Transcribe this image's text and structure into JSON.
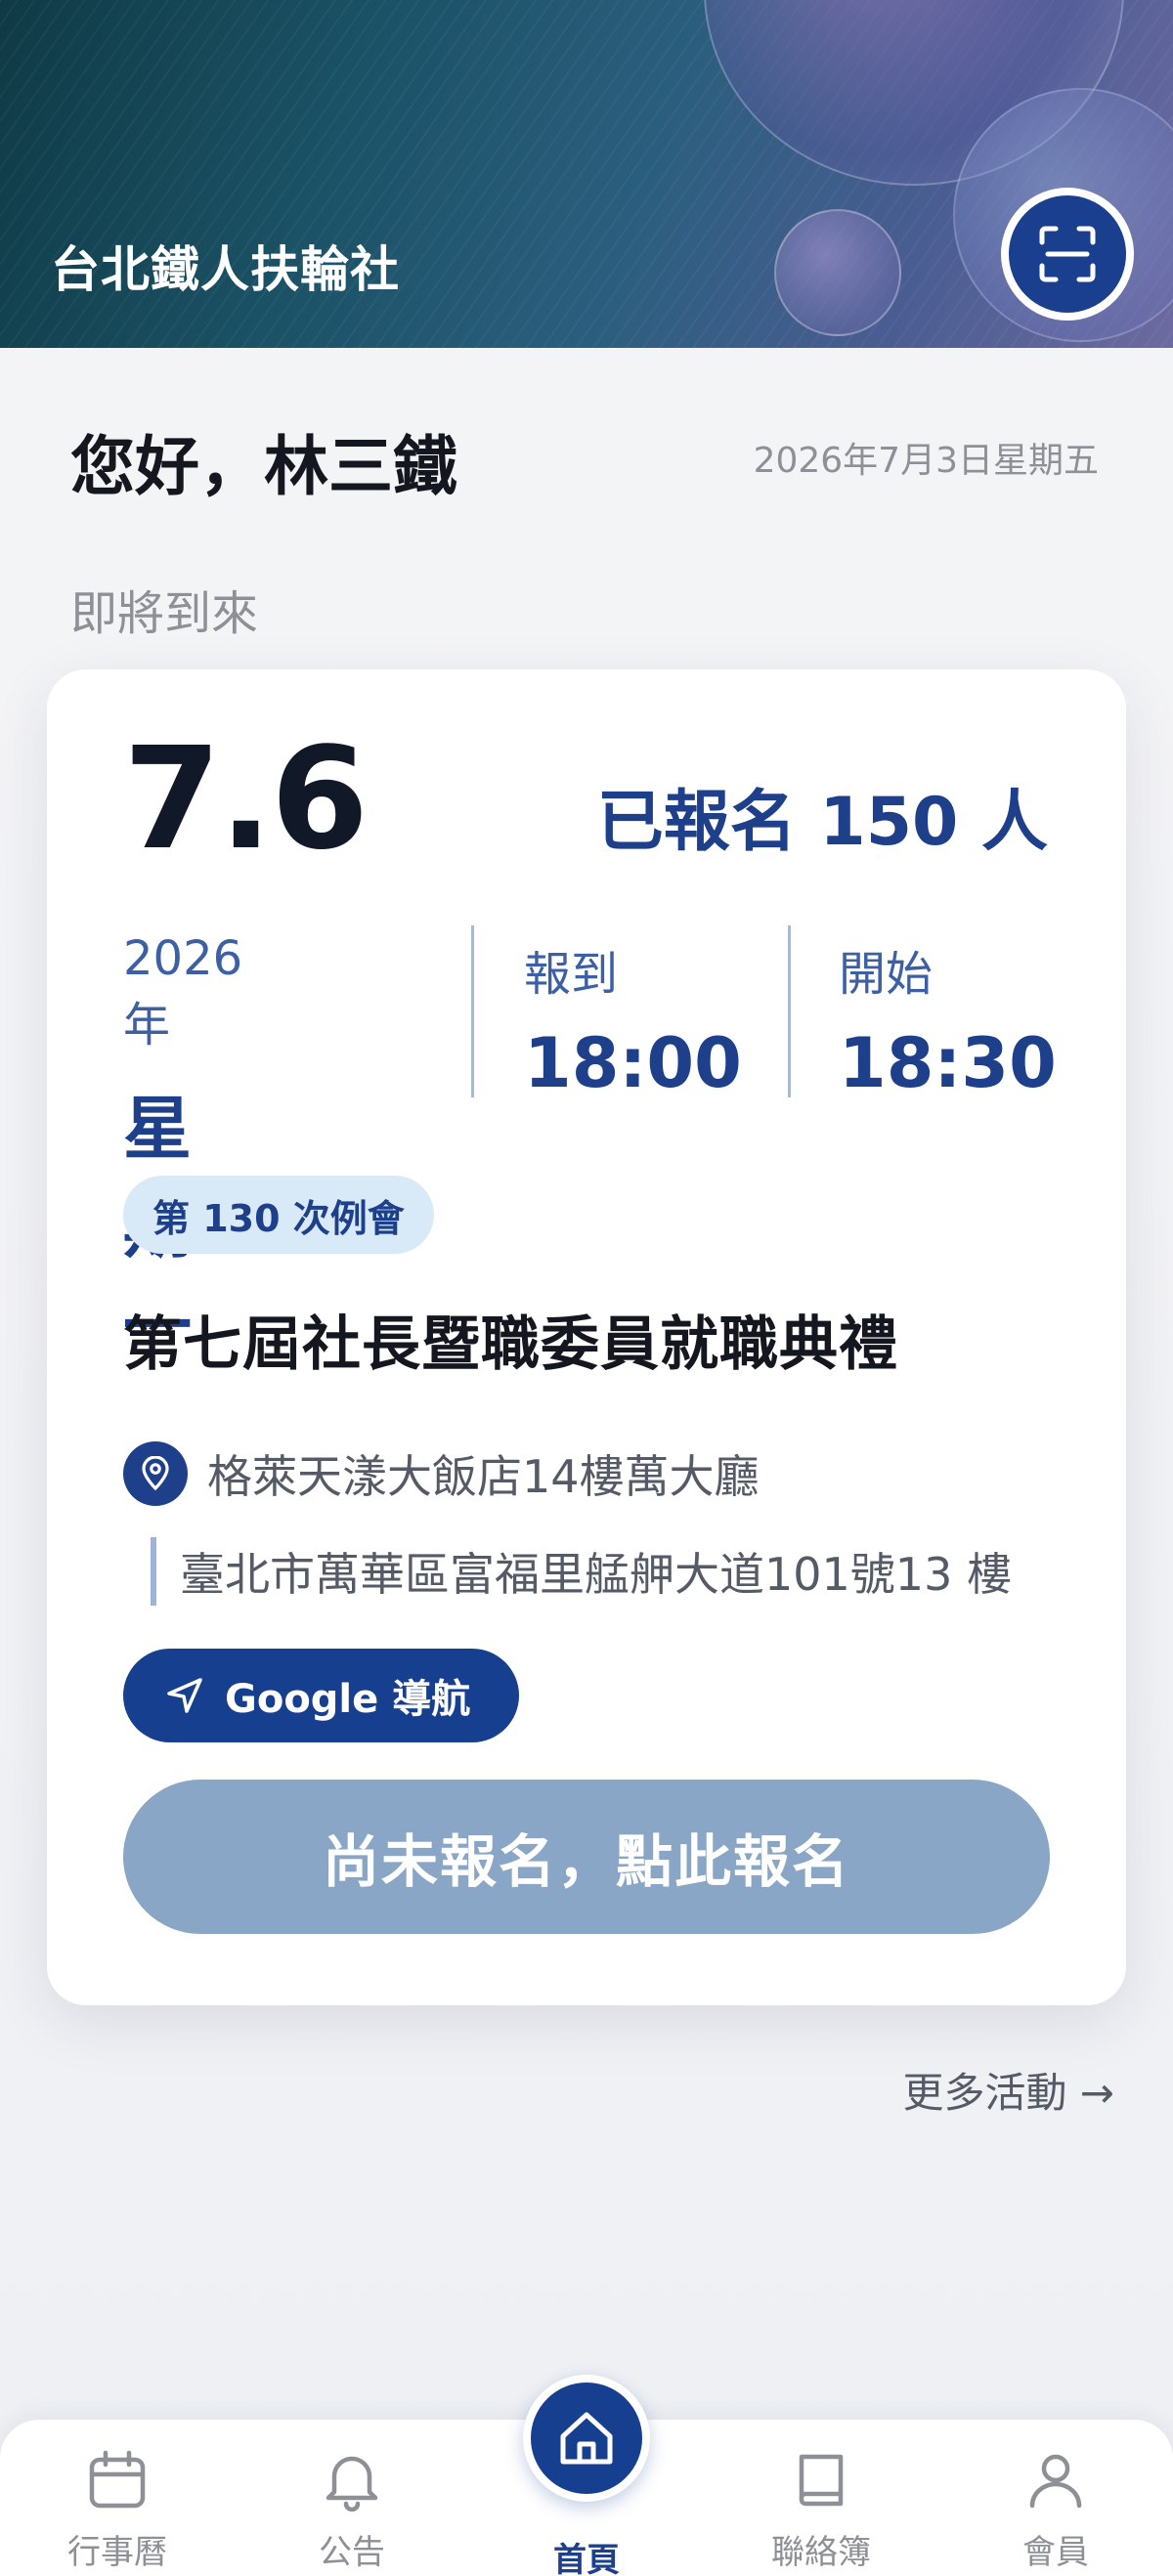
{
  "header": {
    "title": "台北鐵人扶輪社",
    "scan_icon": "qr-scan-icon"
  },
  "greeting": {
    "text": "您好，林三鐵",
    "date": "2026年7月3日星期五"
  },
  "upcoming": {
    "section_label": "即將到來",
    "date": "7.6",
    "registered": "已報名 150 人",
    "year": "2026年",
    "weekday": "星期一",
    "checkin_label": "報到",
    "checkin_time": "18:00",
    "start_label": "開始",
    "start_time": "18:30",
    "meeting_badge": "第 130 次例會",
    "title": "第七屆社長暨職委員就職典禮",
    "venue": "格萊天漾大飯店14樓萬大廳",
    "address": "臺北市萬華區富福里艋舺大道101號13 樓",
    "nav_button": "Google 導航",
    "signup_button": "尚未報名，點此報名"
  },
  "more_link": "更多活動 →",
  "bottom_nav": {
    "items": [
      {
        "label": "行事曆",
        "icon": "calendar-icon"
      },
      {
        "label": "公告",
        "icon": "bell-icon"
      },
      {
        "label": "首頁",
        "icon": "home-icon"
      },
      {
        "label": "聯絡簿",
        "icon": "book-icon"
      },
      {
        "label": "會員",
        "icon": "user-icon"
      }
    ]
  },
  "colors": {
    "primary": "#173f8f",
    "accent_light": "#d8eaf7",
    "disabled_button": "#8aa6c6"
  }
}
